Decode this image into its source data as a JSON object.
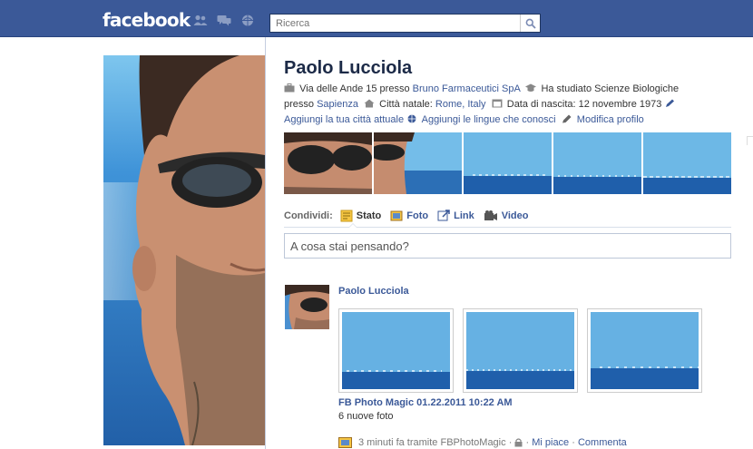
{
  "header": {
    "logo": "facebook",
    "search_placeholder": "Ricerca"
  },
  "profile": {
    "name": "Paolo Lucciola",
    "address_prefix": "Via delle Ande 15 presso",
    "employer": "Bruno Farmaceutici SpA",
    "studied": "Ha studiato Scienze Biologiche",
    "studied_at_prefix": "presso",
    "school": "Sapienza",
    "hometown_label": "Città natale:",
    "hometown": "Rome, Italy",
    "birthday": "Data di nascita: 12 novembre 1973",
    "add_city": "Aggiungi la tua città attuale",
    "add_languages": "Aggiungi le lingue che conosci",
    "edit_profile": "Modifica profilo"
  },
  "share": {
    "label": "Condividi:",
    "items": [
      "Stato",
      "Foto",
      "Link",
      "Video"
    ],
    "composer_placeholder": "A cosa stai pensando?"
  },
  "story": {
    "author": "Paolo Lucciola",
    "album": "FB Photo Magic 01.22.2011 10:22 AM",
    "count": "6 nuove foto",
    "time": "3 minuti fa tramite FBPhotoMagic",
    "sep": "·",
    "like": "Mi piace",
    "comment": "Commenta"
  },
  "colors": {
    "brand": "#3b5998",
    "sea": "#2a6fb5",
    "sky": "#5eb2e6"
  }
}
